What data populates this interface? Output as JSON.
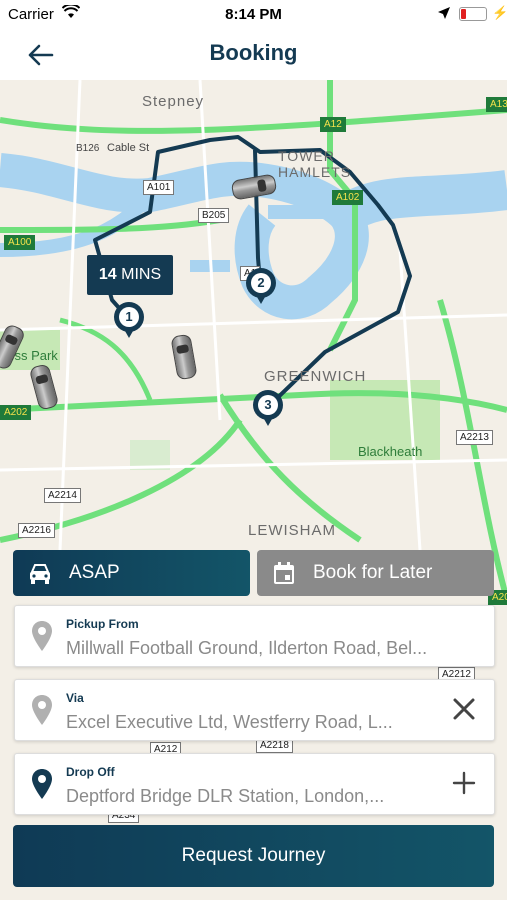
{
  "status_bar": {
    "carrier": "Carrier",
    "time": "8:14 PM",
    "icons": [
      "wifi-icon",
      "location-arrow-icon",
      "battery-icon",
      "charging-bolt-icon"
    ]
  },
  "header": {
    "title": "Booking",
    "back_icon": "back-arrow-icon"
  },
  "map": {
    "area_labels": [
      "Stepney",
      "TOWER HAMLETS",
      "GREENWICH",
      "LEWISHAM",
      "Blackheath",
      "gess Park"
    ],
    "street_labels": [
      "Cable St"
    ],
    "road_shields": [
      "A13",
      "A12",
      "B126",
      "A101",
      "B205",
      "A102",
      "A100",
      "A1",
      "A202",
      "A2213",
      "A2214",
      "A2216",
      "A2212",
      "A2218",
      "A212",
      "A234",
      "A20"
    ],
    "eta": {
      "value": "14",
      "unit": "MINS"
    },
    "waypoints": [
      "1",
      "2",
      "3"
    ],
    "colors": {
      "route": "#143a52",
      "water": "#a9d3f0",
      "major_road": "#6fe07c",
      "park": "#c6e8b5"
    }
  },
  "booking_mode": {
    "asap_label": "ASAP",
    "later_label": "Book for Later",
    "selected": "ASAP",
    "icons": [
      "car-icon",
      "calendar-icon"
    ]
  },
  "pickup": {
    "label": "Pickup From",
    "value": "Millwall Football Ground, Ilderton Road, Bel..."
  },
  "via": {
    "label": "Via",
    "value": "Excel Executive Ltd, Westferry Road, L...",
    "action_icon": "remove-x-icon"
  },
  "dropoff": {
    "label": "Drop Off",
    "value": "Deptford Bridge DLR Station, London,...",
    "action_icon": "add-plus-icon"
  },
  "request_button": {
    "label": "Request Journey"
  },
  "colors": {
    "primary": "#143a52",
    "muted": "#8a8a8a"
  }
}
